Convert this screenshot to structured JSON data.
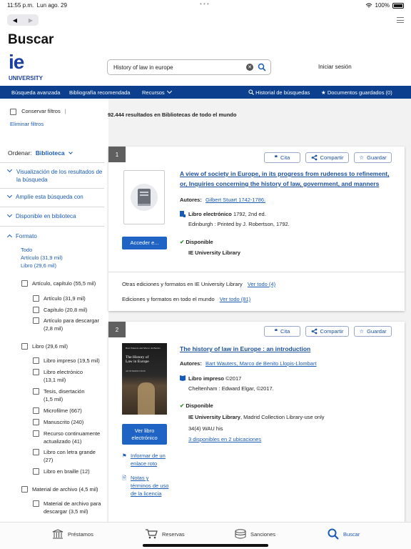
{
  "status": {
    "time": "11:55 p.m.",
    "date": "Lun ago. 29",
    "battery": "100%"
  },
  "nav": {
    "back": "◀",
    "forward": "▶"
  },
  "page_title": "Buscar",
  "logo": {
    "mark": "ie",
    "name": "UNIVERSITY"
  },
  "search": {
    "value": "History of law in europe"
  },
  "header": {
    "login": "Iniciar sesión"
  },
  "bluebar": {
    "advanced": "Búsqueda avanzada",
    "recommended": "Bibliografía recomendada",
    "resources": "Recursos",
    "history": "Historial de búsquedas",
    "saved": "Documentos guardados (0)"
  },
  "filters": {
    "keep": "Conservar filtros",
    "clear": "Eliminar filtros",
    "sort_label": "Ordenar:",
    "sort_value": "Biblioteca",
    "facets": {
      "viz": "Visualización de los resultados de la búsqueda",
      "expand": "Amplíe esta búsqueda con",
      "available": "Disponible en biblioteca",
      "format": "Formato"
    },
    "format_links": [
      "Todo",
      "Artículo (31,9 mil)",
      "Libro (29,6 mil)"
    ],
    "items": [
      {
        "label": "Artículo, capítulo (55,5 mil)",
        "level": 0
      },
      {
        "label": "Artículo (31,9 mil)",
        "level": 1
      },
      {
        "label": "Capítulo (20,8 mil)",
        "level": 1
      },
      {
        "label": "Artículo para descargar (2,8 mil)",
        "level": 1
      },
      {
        "label": "Libro (29,6 mil)",
        "level": 0
      },
      {
        "label": "Libro impreso (19,5 mil)",
        "level": 1
      },
      {
        "label": "Libro electrónico (13,1 mil)",
        "level": 1
      },
      {
        "label": "Tesis, disertación (1,5 mil)",
        "level": 1
      },
      {
        "label": "Microfilme (667)",
        "level": 1
      },
      {
        "label": "Manuscrito (240)",
        "level": 1
      },
      {
        "label": "Recurso continuamente actualizado (41)",
        "level": 1
      },
      {
        "label": "Libro con letra grande (27)",
        "level": 1
      },
      {
        "label": "Libro en braille (12)",
        "level": 1
      },
      {
        "label": "Material de archivo (4,5 mil)",
        "level": 0
      },
      {
        "label": "Material de archivo para descargar (3,5 mil)",
        "level": 1
      }
    ]
  },
  "results": {
    "count_text": "92.444 resultados en Bibliotecas de todo el mundo",
    "actions": {
      "cite": "Cita",
      "share": "Compartir",
      "save": "Guardar"
    },
    "items": [
      {
        "num": "1",
        "title": "A view of society in Europe, in its progress from rudeness to refinement, or, Inquiries concerning the history of law, government, and manners",
        "authors_label": "Autores:",
        "authors": "Gilbert Stuart 1742-1786.",
        "format": "Libro electrónico",
        "format_detail": "1792, 2nd ed.",
        "publisher": "Edinburgh : Printed by J. Robertson, 1792.",
        "availability": "Disponible",
        "library": "IE University Library",
        "button": "Acceder e...",
        "other_editions": "Otras ediciones y formatos en IE University Library",
        "other_link": "Ver todo (4)",
        "world_editions": "Ediciones y formatos en todo el mundo",
        "world_link": "Ver todo (81)"
      },
      {
        "num": "2",
        "title": "The history of law in Europe : an introduction",
        "authors_label": "Autores:",
        "authors": "Bart Wauters, Marco de Benito Llopis-Llombart",
        "format": "Libro impreso",
        "format_detail": "©2017",
        "publisher": "Cheltenham : Edward Elgar, ©2017.",
        "availability": "Disponible",
        "library": "IE University Library",
        "library_detail": ", Madrid Collection Library-use only",
        "callnum": "34(4) WAU his",
        "locations": "3 disponibles en 2 ubicaciones",
        "button": "Ver libro electrónico",
        "report": "Informar de un enlace roto",
        "terms": "Notas y términos de uso de la licencia",
        "cover": {
          "authors": "Bart Wauters and Marco de Benito",
          "title": "The History of Law in Europe",
          "subtitle": "AN INTRODUCTION"
        }
      }
    ]
  },
  "tabbar": {
    "loans": "Préstamos",
    "holds": "Reservas",
    "fines": "Sanciones",
    "search": "Buscar"
  },
  "colors": {
    "brand": "#0c3f8d",
    "link": "#1a5bb5",
    "button": "#1f64c4",
    "available": "#2e8b2e"
  }
}
